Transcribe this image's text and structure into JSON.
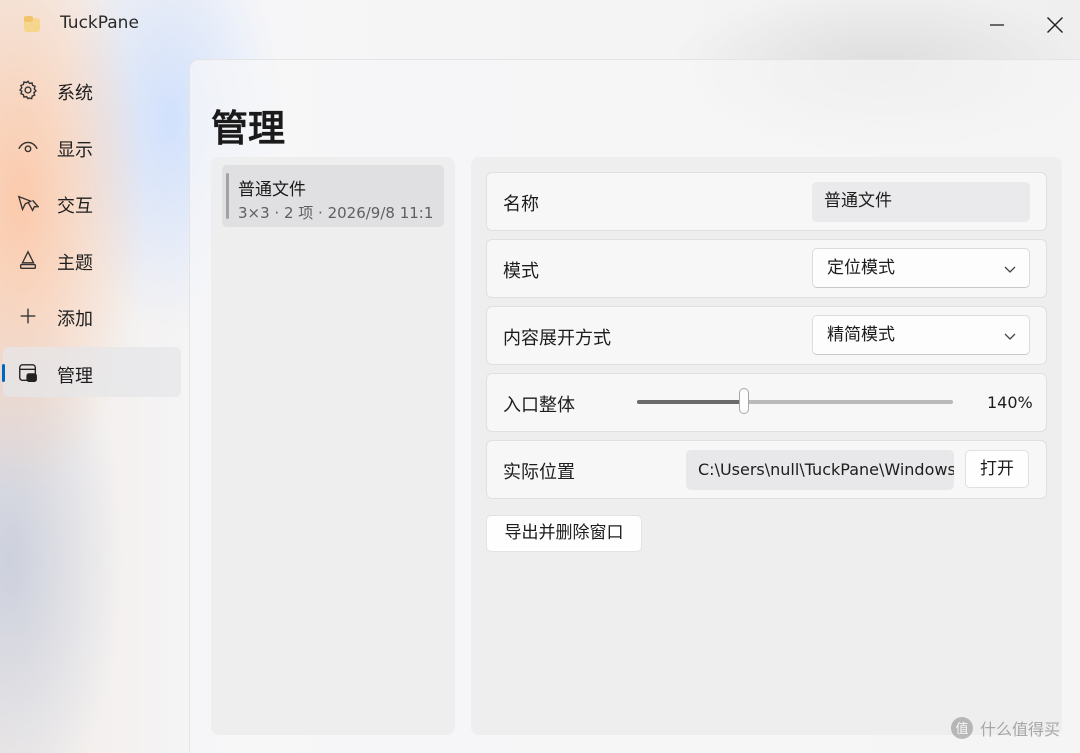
{
  "app": {
    "title": "TuckPane"
  },
  "window_controls": {
    "minimize_icon": "minimize-icon",
    "close_icon": "close-icon"
  },
  "sidebar": {
    "items": [
      {
        "label": "系统",
        "icon": "gear-icon",
        "active": false
      },
      {
        "label": "显示",
        "icon": "eye-icon",
        "active": false
      },
      {
        "label": "交互",
        "icon": "cursor-icon",
        "active": false
      },
      {
        "label": "主题",
        "icon": "paint-icon",
        "active": false
      },
      {
        "label": "添加",
        "icon": "plus-icon",
        "active": false
      },
      {
        "label": "管理",
        "icon": "manage-icon",
        "active": true
      }
    ]
  },
  "page": {
    "title": "管理"
  },
  "list": {
    "items": [
      {
        "title": "普通文件",
        "subtitle": "3×3 · 2 项 · 2026/9/8 11:1"
      }
    ]
  },
  "detail": {
    "name": {
      "label": "名称",
      "value": "普通文件"
    },
    "mode": {
      "label": "模式",
      "value": "定位模式"
    },
    "expand": {
      "label": "内容展开方式",
      "value": "精简模式"
    },
    "scale": {
      "label": "入口整体",
      "value_text": "140%",
      "slider_fraction": 0.34
    },
    "location": {
      "label": "实际位置",
      "path": "C:\\Users\\null\\TuckPane\\Windows",
      "open_label": "打开"
    },
    "export_label": "导出并删除窗口"
  },
  "accent_color": "#0067c0",
  "watermark": {
    "text": "什么值得买"
  }
}
